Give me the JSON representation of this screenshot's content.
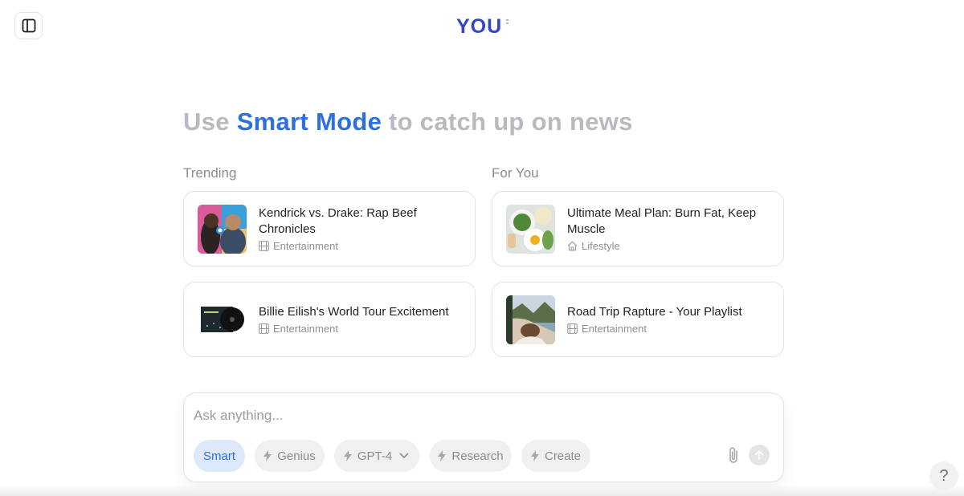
{
  "logo": {
    "text": "YOU"
  },
  "headline": {
    "prefix": "Use ",
    "accent": "Smart Mode",
    "suffix": " to catch up on news"
  },
  "sections": {
    "trending_label": "Trending",
    "for_you_label": "For You"
  },
  "trending": [
    {
      "title": "Kendrick vs. Drake: Rap Beef Chronicles",
      "category": "Entertainment",
      "category_icon": "film-icon"
    },
    {
      "title": "Billie Eilish's World Tour Excitement",
      "category": "Entertainment",
      "category_icon": "film-icon"
    }
  ],
  "for_you": [
    {
      "title": "Ultimate Meal Plan: Burn Fat, Keep Muscle",
      "category": "Lifestyle",
      "category_icon": "home-icon"
    },
    {
      "title": "Road Trip Rapture - Your Playlist",
      "category": "Entertainment",
      "category_icon": "film-icon"
    }
  ],
  "ask": {
    "placeholder": "Ask anything...",
    "modes": [
      {
        "label": "Smart",
        "active": true
      },
      {
        "label": "Genius",
        "active": false
      },
      {
        "label": "GPT-4",
        "active": false,
        "dropdown": true
      },
      {
        "label": "Research",
        "active": false
      },
      {
        "label": "Create",
        "active": false
      }
    ]
  },
  "help": {
    "label": "?"
  },
  "colors": {
    "accent": "#2d6fe0",
    "muted_text": "#b9b9c0",
    "active_mode_bg": "#dde8fb",
    "logo": "#3344c9"
  }
}
